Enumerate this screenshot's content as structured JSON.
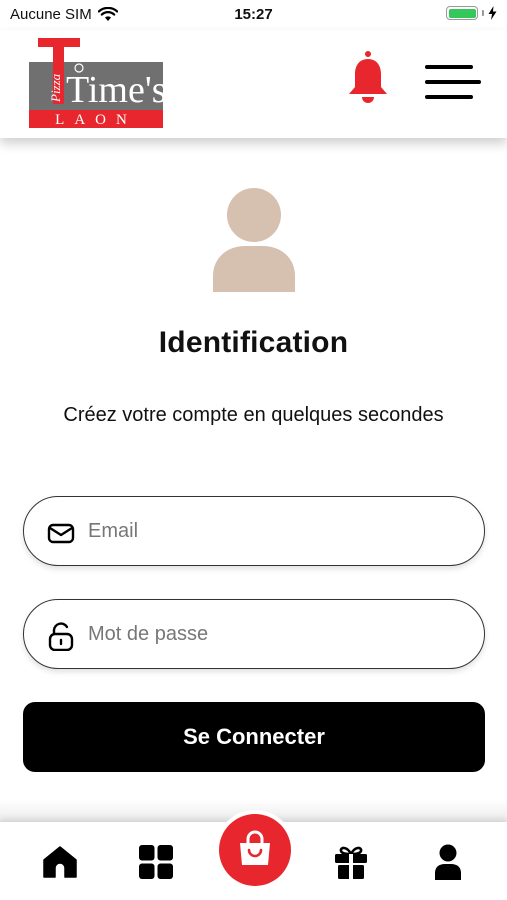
{
  "status_bar": {
    "carrier": "Aucune SIM",
    "time": "15:27",
    "battery_level": 1.0,
    "wifi_icon": "wifi-icon",
    "charging_icon": "bolt-icon"
  },
  "header": {
    "logo": {
      "brand_small": "Pizza",
      "brand_main": "Time's",
      "city": "LAON",
      "colors": {
        "red": "#e8262d",
        "gray": "#707070"
      }
    },
    "notification_icon": "bell-icon",
    "notification_color": "#e8262d",
    "menu_icon": "hamburger-menu-icon"
  },
  "identification": {
    "avatar_icon": "user-avatar-icon",
    "avatar_color": "#d6c1b1",
    "title": "Identification",
    "subtitle": "Créez votre compte en quelques secondes"
  },
  "form": {
    "email": {
      "placeholder": "Email",
      "value": "",
      "icon": "envelope-icon"
    },
    "password": {
      "placeholder": "Mot de passe",
      "value": "",
      "icon": "unlock-icon"
    },
    "submit_label": "Se Connecter"
  },
  "bottom_nav": {
    "items": [
      {
        "name": "home",
        "icon": "home-icon"
      },
      {
        "name": "menu",
        "icon": "grid-icon"
      },
      {
        "name": "cart",
        "icon": "shopping-bag-icon",
        "color": "#e8262d"
      },
      {
        "name": "gifts",
        "icon": "gift-icon"
      },
      {
        "name": "account",
        "icon": "user-icon"
      }
    ]
  }
}
